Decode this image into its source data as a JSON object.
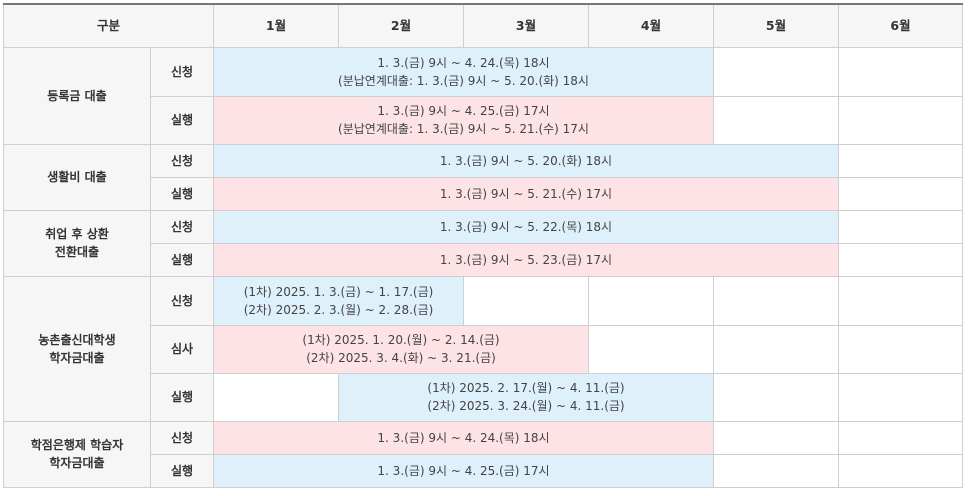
{
  "header": {
    "category": "구분",
    "months": [
      "1월",
      "2월",
      "3월",
      "4월",
      "5월",
      "6월"
    ]
  },
  "groups": [
    {
      "name": "등록금 대출",
      "rows": [
        {
          "label": "신청",
          "line1": "1. 3.(금) 9시 ~ 4. 24.(목) 18시",
          "line2": "(분납연계대출: 1. 3.(금) 9시 ~ 5. 20.(화) 18시"
        },
        {
          "label": "실행",
          "line1": "1. 3.(금) 9시 ~ 4. 25.(금) 17시",
          "line2": "(분납연계대출: 1. 3.(금) 9시 ~ 5. 21.(수) 17시"
        }
      ]
    },
    {
      "name": "생활비 대출",
      "rows": [
        {
          "label": "신청",
          "line1": "1. 3.(금) 9시 ~ 5. 20.(화) 18시"
        },
        {
          "label": "실행",
          "line1": "1. 3.(금) 9시 ~ 5. 21.(수) 17시"
        }
      ]
    },
    {
      "name_line1": "취업 후 상환",
      "name_line2": "전환대출",
      "rows": [
        {
          "label": "신청",
          "line1": "1. 3.(금) 9시 ~ 5. 22.(목) 18시"
        },
        {
          "label": "실행",
          "line1": "1. 3.(금) 9시 ~ 5. 23.(금) 17시"
        }
      ]
    },
    {
      "name_line1": "농촌출신대학생",
      "name_line2": "학자금대출",
      "rows": [
        {
          "label": "신청",
          "line1": "(1차) 2025. 1. 3.(금) ~ 1. 17.(금)",
          "line2": "(2차) 2025. 2. 3.(월) ~ 2. 28.(금)"
        },
        {
          "label": "심사",
          "line1": "(1차) 2025. 1. 20.(월) ~ 2. 14.(금)",
          "line2": "(2차) 2025. 3. 4.(화) ~ 3. 21.(금)"
        },
        {
          "label": "실행",
          "line1": "(1차) 2025. 2. 17.(월) ~ 4. 11.(금)",
          "line2": "(2차) 2025. 3. 24.(월) ~ 4. 11.(금)"
        }
      ]
    },
    {
      "name_line1": "학점은행제 학습자",
      "name_line2": "학자금대출",
      "rows": [
        {
          "label": "신청",
          "line1": "1. 3.(금) 9시 ~ 4. 24.(목) 18시"
        },
        {
          "label": "실행",
          "line1": "1. 3.(금) 9시 ~ 4. 25.(금) 17시"
        }
      ]
    }
  ]
}
